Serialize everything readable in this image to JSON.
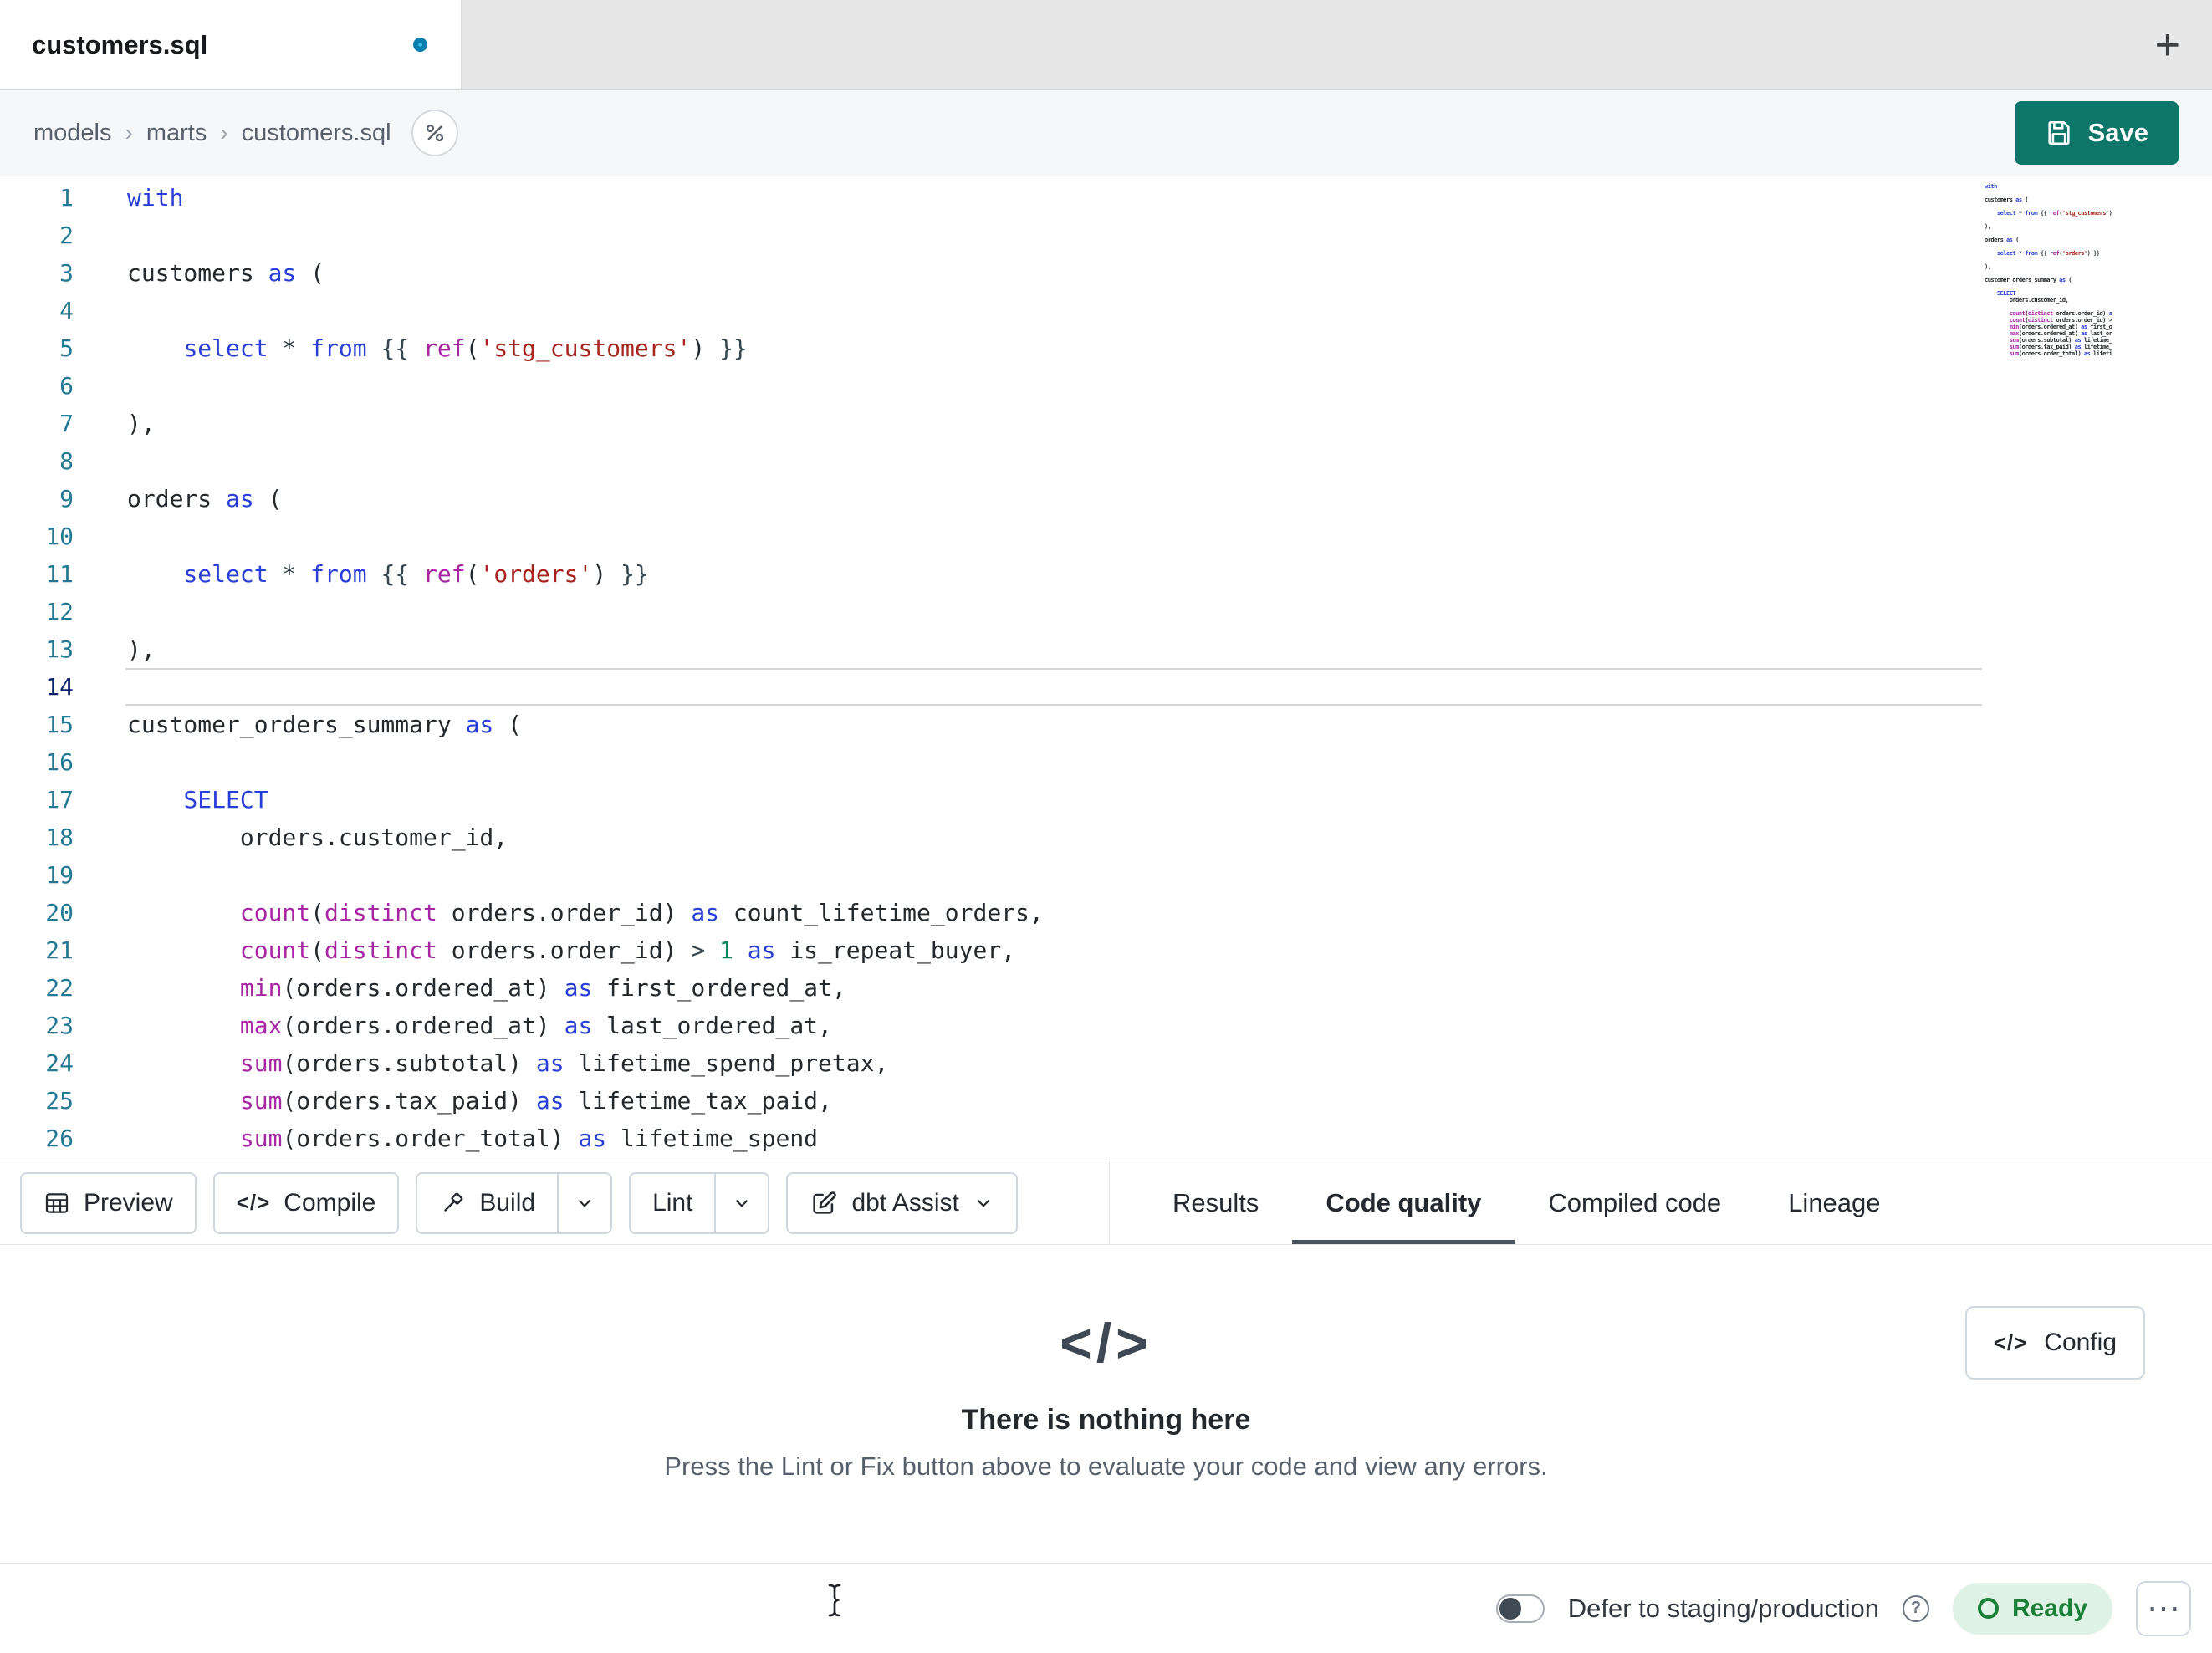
{
  "colors": {
    "accent": "#0e7569",
    "tab_dot": "#0a7fae",
    "keyword": "#2a3fd6",
    "function": "#a626a4",
    "string": "#a8251f",
    "number": "#098658",
    "operator": "#37474f",
    "line_number": "#237893",
    "ready_green": "#1a7f37",
    "ready_bg": "#e0f2e6"
  },
  "tab_bar": {
    "active_tab": "customers.sql",
    "add_symbol": "+"
  },
  "breadcrumb": {
    "items": [
      "models",
      "marts",
      "customers.sql"
    ],
    "separator": "›"
  },
  "save": {
    "label": "Save"
  },
  "icons": {
    "code_glyph": "</>"
  },
  "editor": {
    "current_line": "14",
    "lines": [
      {
        "n": "1",
        "tokens": [
          [
            "kw",
            "with"
          ]
        ]
      },
      {
        "n": "2",
        "tokens": []
      },
      {
        "n": "3",
        "tokens": [
          [
            "def",
            "customers "
          ],
          [
            "kw",
            "as"
          ],
          [
            "def",
            " ("
          ]
        ]
      },
      {
        "n": "4",
        "tokens": []
      },
      {
        "n": "5",
        "tokens": [
          [
            "def",
            "    "
          ],
          [
            "kw",
            "select"
          ],
          [
            "def",
            " "
          ],
          [
            "op",
            "*"
          ],
          [
            "def",
            " "
          ],
          [
            "kw",
            "from"
          ],
          [
            "def",
            " "
          ],
          [
            "op",
            "{{"
          ],
          [
            "def",
            " "
          ],
          [
            "fn",
            "ref"
          ],
          [
            "def",
            "("
          ],
          [
            "str",
            "'stg_customers'"
          ],
          [
            "def",
            ") "
          ],
          [
            "op",
            "}}"
          ]
        ]
      },
      {
        "n": "6",
        "tokens": []
      },
      {
        "n": "7",
        "tokens": [
          [
            "def",
            "),"
          ]
        ]
      },
      {
        "n": "8",
        "tokens": []
      },
      {
        "n": "9",
        "tokens": [
          [
            "def",
            "orders "
          ],
          [
            "kw",
            "as"
          ],
          [
            "def",
            " ("
          ]
        ]
      },
      {
        "n": "10",
        "tokens": []
      },
      {
        "n": "11",
        "tokens": [
          [
            "def",
            "    "
          ],
          [
            "kw",
            "select"
          ],
          [
            "def",
            " "
          ],
          [
            "op",
            "*"
          ],
          [
            "def",
            " "
          ],
          [
            "kw",
            "from"
          ],
          [
            "def",
            " "
          ],
          [
            "op",
            "{{"
          ],
          [
            "def",
            " "
          ],
          [
            "fn",
            "ref"
          ],
          [
            "def",
            "("
          ],
          [
            "str",
            "'orders'"
          ],
          [
            "def",
            ") "
          ],
          [
            "op",
            "}}"
          ]
        ]
      },
      {
        "n": "12",
        "tokens": []
      },
      {
        "n": "13",
        "tokens": [
          [
            "def",
            "),"
          ]
        ]
      },
      {
        "n": "14",
        "tokens": []
      },
      {
        "n": "15",
        "tokens": [
          [
            "def",
            "customer_orders_summary "
          ],
          [
            "kw",
            "as"
          ],
          [
            "def",
            " ("
          ]
        ]
      },
      {
        "n": "16",
        "tokens": []
      },
      {
        "n": "17",
        "tokens": [
          [
            "def",
            "    "
          ],
          [
            "kw",
            "SELECT"
          ]
        ]
      },
      {
        "n": "18",
        "tokens": [
          [
            "def",
            "        orders.customer_id,"
          ]
        ]
      },
      {
        "n": "19",
        "tokens": []
      },
      {
        "n": "20",
        "tokens": [
          [
            "def",
            "        "
          ],
          [
            "fn",
            "count"
          ],
          [
            "def",
            "("
          ],
          [
            "fn",
            "distinct"
          ],
          [
            "def",
            " orders.order_id) "
          ],
          [
            "kw",
            "as"
          ],
          [
            "def",
            " count_lifetime_orders,"
          ]
        ]
      },
      {
        "n": "21",
        "tokens": [
          [
            "def",
            "        "
          ],
          [
            "fn",
            "count"
          ],
          [
            "def",
            "("
          ],
          [
            "fn",
            "distinct"
          ],
          [
            "def",
            " orders.order_id) "
          ],
          [
            "op",
            ">"
          ],
          [
            "def",
            " "
          ],
          [
            "num",
            "1"
          ],
          [
            "def",
            " "
          ],
          [
            "kw",
            "as"
          ],
          [
            "def",
            " is_repeat_buyer,"
          ]
        ]
      },
      {
        "n": "22",
        "tokens": [
          [
            "def",
            "        "
          ],
          [
            "fn",
            "min"
          ],
          [
            "def",
            "(orders.ordered_at) "
          ],
          [
            "kw",
            "as"
          ],
          [
            "def",
            " first_ordered_at,"
          ]
        ]
      },
      {
        "n": "23",
        "tokens": [
          [
            "def",
            "        "
          ],
          [
            "fn",
            "max"
          ],
          [
            "def",
            "(orders.ordered_at) "
          ],
          [
            "kw",
            "as"
          ],
          [
            "def",
            " last_ordered_at,"
          ]
        ]
      },
      {
        "n": "24",
        "tokens": [
          [
            "def",
            "        "
          ],
          [
            "fn",
            "sum"
          ],
          [
            "def",
            "(orders.subtotal) "
          ],
          [
            "kw",
            "as"
          ],
          [
            "def",
            " lifetime_spend_pretax,"
          ]
        ]
      },
      {
        "n": "25",
        "tokens": [
          [
            "def",
            "        "
          ],
          [
            "fn",
            "sum"
          ],
          [
            "def",
            "(orders.tax_paid) "
          ],
          [
            "kw",
            "as"
          ],
          [
            "def",
            " lifetime_tax_paid,"
          ]
        ]
      },
      {
        "n": "26",
        "tokens": [
          [
            "def",
            "        "
          ],
          [
            "fn",
            "sum"
          ],
          [
            "def",
            "(orders.order_total) "
          ],
          [
            "kw",
            "as"
          ],
          [
            "def",
            " lifetime_spend"
          ]
        ]
      }
    ]
  },
  "toolbar": {
    "preview": "Preview",
    "compile": "Compile",
    "build": "Build",
    "lint": "Lint",
    "assist": "dbt Assist",
    "tabs": [
      {
        "label": "Results",
        "active": false
      },
      {
        "label": "Code quality",
        "active": true
      },
      {
        "label": "Compiled code",
        "active": false
      },
      {
        "label": "Lineage",
        "active": false
      }
    ]
  },
  "results": {
    "config_label": "Config",
    "empty_icon": "</>",
    "empty_title": "There is nothing here",
    "empty_subtitle": "Press the Lint or Fix button above to evaluate your code and view any errors."
  },
  "status_bar": {
    "defer_label": "Defer to staging/production",
    "help_symbol": "?",
    "ready_label": "Ready",
    "more_symbol": "⋯"
  }
}
